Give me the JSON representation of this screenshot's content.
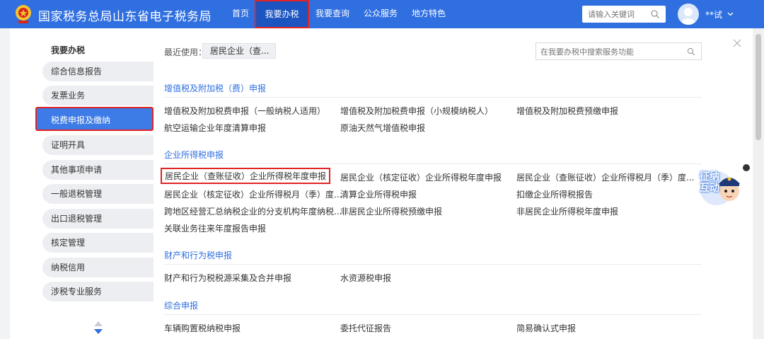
{
  "header": {
    "site_title": "国家税务总局山东省电子税务局",
    "nav": [
      "首页",
      "我要办税",
      "我要查询",
      "公众服务",
      "地方特色"
    ],
    "active_nav": "我要办税",
    "search_placeholder": "请输入关键词",
    "username": "**试",
    "accent_color": "#2f6fe0"
  },
  "sidebar": {
    "title": "我要办税",
    "items": [
      "综合信息报告",
      "发票业务",
      "税费申报及缴纳",
      "证明开具",
      "其他事项申请",
      "一般退税管理",
      "出口退税管理",
      "核定管理",
      "纳税信用",
      "涉税专业服务"
    ],
    "active_item": "税费申报及缴纳"
  },
  "main": {
    "recent_label": "最近使用：",
    "recent_chip": "居民企业（查...",
    "search_placeholder": "在我要办税中搜索服务功能",
    "sections": [
      {
        "title": "增值税及附加税（费）申报",
        "links": [
          "增值税及附加税费申报（一般纳税人适用）",
          "增值税及附加税费申报（小规模纳税人）",
          "增值税及附加税费预缴申报",
          "航空运输企业年度清算申报",
          "原油天然气增值税申报"
        ]
      },
      {
        "title": "企业所得税申报",
        "links": [
          "居民企业（查账征收）企业所得税年度申报",
          "居民企业（核定征收）企业所得税年度申报",
          "居民企业（查账征收）企业所得税月（季）度...",
          "居民企业（核定征收）企业所得税月（季）度...",
          "清算企业所得税申报",
          "扣缴企业所得税报告",
          "跨地区经营汇总纳税企业的分支机构年度纳税...",
          "非居民企业所得税预缴申报",
          "非居民企业所得税年度申报",
          "关联业务往来年度报告申报"
        ]
      },
      {
        "title": "财产和行为税申报",
        "links": [
          "财产和行为税税源采集及合并申报",
          "水资源税申报"
        ]
      },
      {
        "title": "综合申报",
        "links": [
          "车辆购置税纳税申报",
          "委托代征报告",
          "简易确认式申报"
        ]
      }
    ]
  },
  "mascot": {
    "text": "征纳互动"
  }
}
